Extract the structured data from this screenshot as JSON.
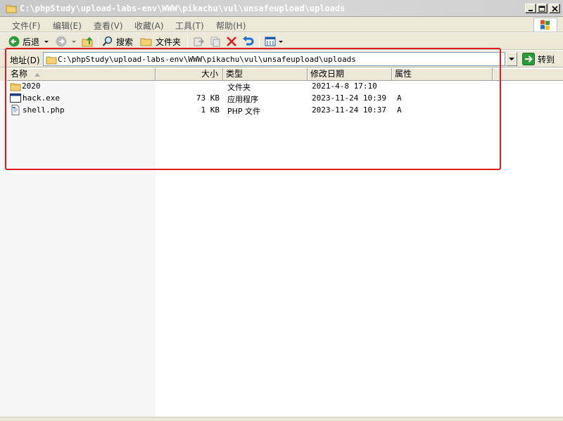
{
  "window": {
    "title": "C:\\phpStudy\\upload-labs-env\\WWW\\pikachu\\vul\\unsafeupload\\uploads"
  },
  "menu": {
    "items": [
      {
        "label": "文件(F)"
      },
      {
        "label": "编辑(E)"
      },
      {
        "label": "查看(V)"
      },
      {
        "label": "收藏(A)"
      },
      {
        "label": "工具(T)"
      },
      {
        "label": "帮助(H)"
      }
    ]
  },
  "toolbar": {
    "back_label": "后退",
    "search_label": "搜索",
    "folders_label": "文件夹"
  },
  "address": {
    "label": "地址(D)",
    "value": "C:\\phpStudy\\upload-labs-env\\WWW\\pikachu\\vul\\unsafeupload\\uploads",
    "go_label": "转到"
  },
  "columns": {
    "name": "名称",
    "size": "大小",
    "type": "类型",
    "modified": "修改日期",
    "attributes": "属性"
  },
  "files": [
    {
      "name": "2020",
      "size": "",
      "type": "文件夹",
      "modified": "2021-4-8 17:10",
      "attr": "",
      "icon": "folder-icon"
    },
    {
      "name": "hack.exe",
      "size": "73 KB",
      "type": "应用程序",
      "modified": "2023-11-24 10:39",
      "attr": "A",
      "icon": "exe-icon"
    },
    {
      "name": "shell.php",
      "size": "1 KB",
      "type": "PHP 文件",
      "modified": "2023-11-24 10:37",
      "attr": "A",
      "icon": "php-file-icon"
    }
  ],
  "colors": {
    "annotation": "#e01b1b",
    "chrome": "#ece9d8",
    "title_bar": "#c8c8c8"
  }
}
